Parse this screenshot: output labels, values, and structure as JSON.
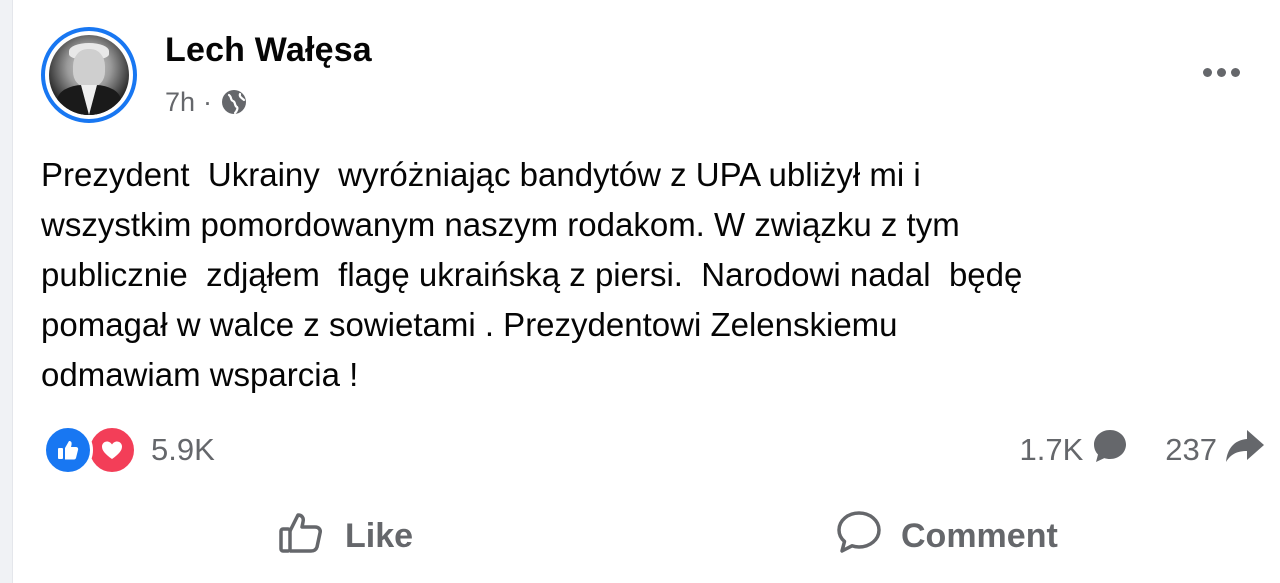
{
  "post": {
    "author_name": "Lech Wałęsa",
    "time": "7h",
    "separator": "·",
    "visibility_icon": "globe-icon",
    "text": "Prezydent  Ukrainy  wyróżniając bandytów z UPA ubliżył mi i\nwszystkim pomordowanym naszym rodakom. W związku z tym\npublicznie  zdjąłem  flagę ukraińską z piersi.  Narodowi nadal  będę\npomagał w walce z sowietami . Prezydentowi Zelenskiemu\nodmawiam wsparcia !"
  },
  "stats": {
    "reactions_count": "5.9K",
    "comments_count": "1.7K",
    "shares_count": "237"
  },
  "actions": {
    "like_label": "Like",
    "comment_label": "Comment"
  },
  "colors": {
    "accent": "#1877f2",
    "love": "#f33e58",
    "muted_text": "#65676b",
    "text": "#050505"
  }
}
